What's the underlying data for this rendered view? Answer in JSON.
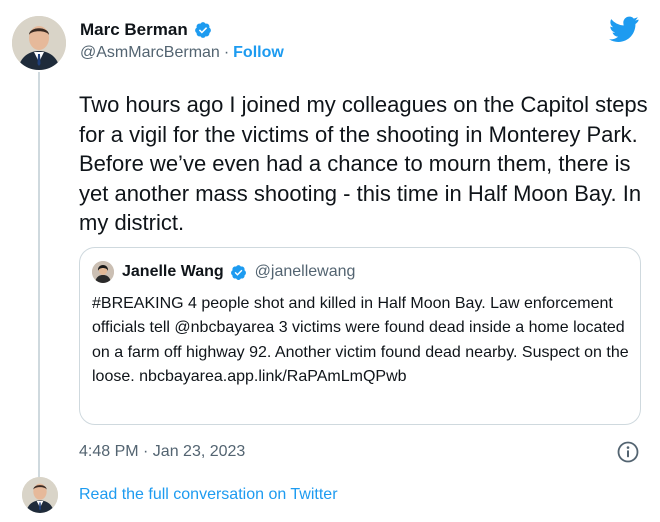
{
  "author": {
    "name": "Marc Berman",
    "handle": "@AsmMarcBerman",
    "separator": "·",
    "follow_label": "Follow",
    "verified": true
  },
  "tweet": {
    "text": "Two hours ago I joined my colleagues on the Capitol steps for a vigil for the victims of the shooting in Monterey Park. Before we’ve even had a chance to mourn them, there is yet another mass shooting - this time in Half Moon Bay. In my district.",
    "timestamp": "4:48 PM · Jan 23, 2023"
  },
  "quoted_tweet": {
    "name": "Janelle Wang",
    "handle": "@janellewang",
    "verified": true,
    "text": "#BREAKING 4 people shot and killed in Half Moon Bay.  Law enforcement officials tell @nbcbayarea 3 victims were found dead inside a home located on a farm off highway 92.  Another victim found dead nearby.  Suspect on the loose. nbcbayarea.app.link/RaPAmLmQPwb"
  },
  "footer": {
    "read_conversation_label": "Read the full conversation on Twitter"
  },
  "icons": {
    "brand": "twitter-bird-icon",
    "verified": "verified-badge-icon",
    "info": "info-icon"
  },
  "colors": {
    "accent": "#1d9bf0",
    "text": "#0f1419",
    "muted": "#536471",
    "border": "#cfd9de"
  }
}
